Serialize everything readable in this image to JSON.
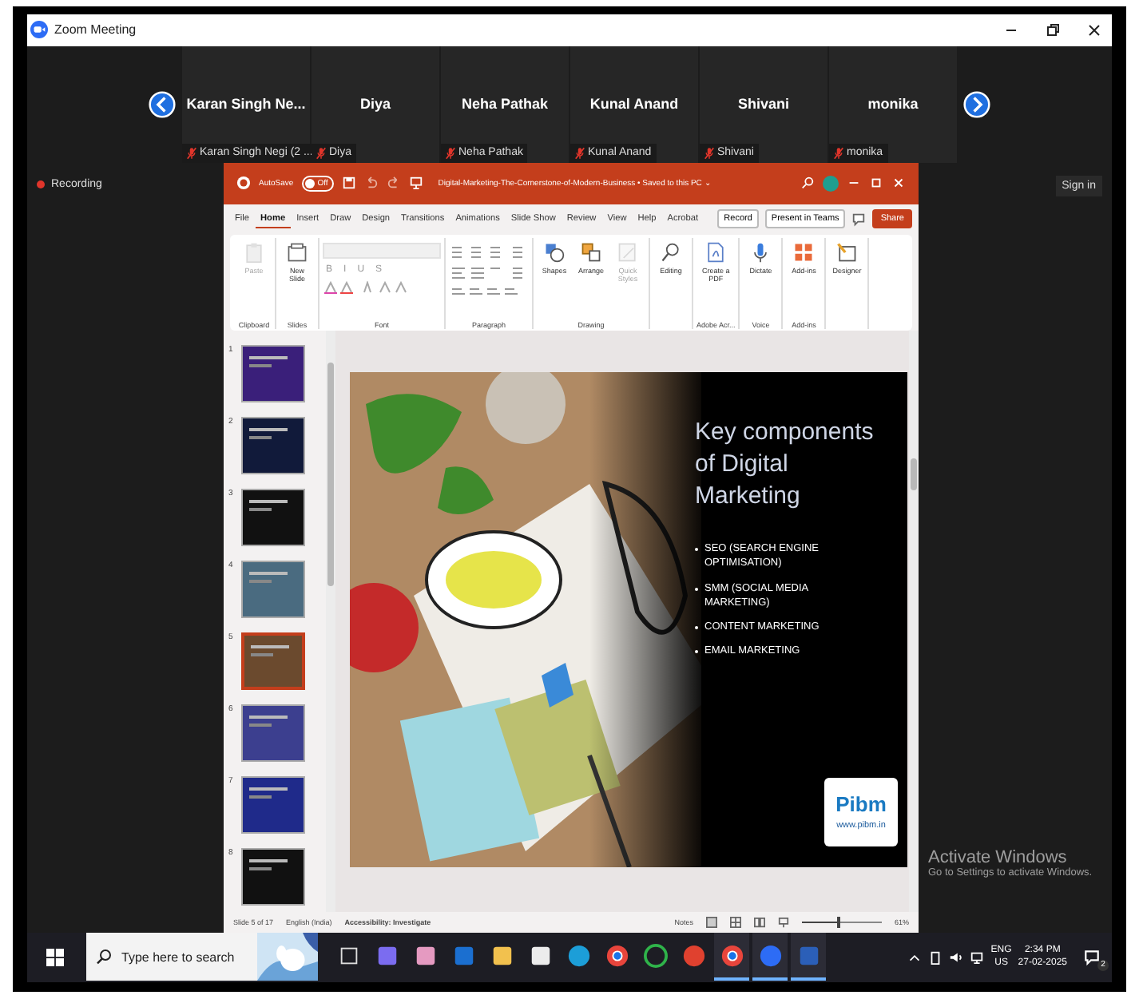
{
  "window": {
    "title": "Zoom Meeting"
  },
  "participants": [
    {
      "name": "Karan Singh Ne...",
      "label": "Karan Singh Negi (2 ...",
      "muted": true
    },
    {
      "name": "Diya",
      "label": "Diya",
      "muted": true
    },
    {
      "name": "Neha Pathak",
      "label": "Neha Pathak",
      "muted": true
    },
    {
      "name": "Kunal Anand",
      "label": "Kunal Anand",
      "muted": true
    },
    {
      "name": "Shivani",
      "label": "Shivani",
      "muted": true
    },
    {
      "name": "monika",
      "label": "monika",
      "muted": true
    }
  ],
  "recording": {
    "label": "Recording"
  },
  "sign_in": "Sign in",
  "powerpoint": {
    "autosave": {
      "label": "AutoSave",
      "state": "Off",
      "on": false
    },
    "file_title": "Digital-Marketing-The-Cornerstone-of-Modern-Business • Saved to this PC ⌄",
    "tabs": [
      {
        "label": "File",
        "selected": false
      },
      {
        "label": "Home",
        "selected": true
      },
      {
        "label": "Insert",
        "selected": false
      },
      {
        "label": "Draw",
        "selected": false
      },
      {
        "label": "Design",
        "selected": false
      },
      {
        "label": "Transitions",
        "selected": false
      },
      {
        "label": "Animations",
        "selected": false
      },
      {
        "label": "Slide Show",
        "selected": false
      },
      {
        "label": "Review",
        "selected": false
      },
      {
        "label": "View",
        "selected": false
      },
      {
        "label": "Help",
        "selected": false
      },
      {
        "label": "Acrobat",
        "selected": false
      }
    ],
    "record": "Record",
    "present": "Present in Teams",
    "share": "Share",
    "ribbon_groups": [
      {
        "kind": "buttons",
        "label": "Clipboard",
        "buttons": [
          {
            "kind": "paste",
            "label": "Paste",
            "disabled": true
          }
        ]
      },
      {
        "kind": "buttons",
        "label": "Slides",
        "buttons": [
          {
            "kind": "new-slide",
            "label": "New Slide",
            "disabled": false
          }
        ]
      },
      {
        "kind": "font",
        "label": "Font",
        "font_buttons": [
          "B",
          "I",
          "U",
          "S"
        ]
      },
      {
        "kind": "paragraph",
        "label": "Paragraph"
      },
      {
        "kind": "buttons",
        "label": "Drawing",
        "buttons": [
          {
            "kind": "shapes",
            "label": "Shapes",
            "disabled": false
          },
          {
            "kind": "arrange",
            "label": "Arrange",
            "disabled": false
          },
          {
            "kind": "quick-styles",
            "label": "Quick Styles",
            "disabled": true
          }
        ]
      },
      {
        "kind": "buttons",
        "buttons": [
          {
            "kind": "search",
            "label": "Editing",
            "disabled": false
          }
        ]
      },
      {
        "kind": "buttons",
        "label": "Adobe Acr...",
        "buttons": [
          {
            "kind": "pdf",
            "label": "Create a PDF",
            "disabled": false
          }
        ]
      },
      {
        "kind": "buttons",
        "label": "Voice",
        "buttons": [
          {
            "kind": "mic",
            "label": "Dictate",
            "disabled": false
          }
        ]
      },
      {
        "kind": "buttons",
        "label": "Add-ins",
        "buttons": [
          {
            "kind": "add-ins",
            "label": "Add-ins",
            "disabled": false
          }
        ]
      },
      {
        "kind": "buttons",
        "buttons": [
          {
            "kind": "designer",
            "label": "Designer",
            "disabled": false
          }
        ]
      }
    ],
    "thumbnails": [
      {
        "number": "1",
        "selected": false
      },
      {
        "number": "2",
        "selected": false
      },
      {
        "number": "3",
        "selected": false
      },
      {
        "number": "4",
        "selected": false
      },
      {
        "number": "5",
        "selected": true
      },
      {
        "number": "6",
        "selected": false
      },
      {
        "number": "7",
        "selected": false
      },
      {
        "number": "8",
        "selected": false
      }
    ],
    "slide": {
      "heading": "Key components of Digital Marketing",
      "bullets": [
        "SEO (SEARCH ENGINE OPTIMISATION)",
        "SMM (SOCIAL MEDIA MARKETING)",
        "CONTENT MARKETING",
        "EMAIL MARKETING"
      ],
      "logo": "Pibm",
      "logo_url": "www.pibm.in"
    },
    "status_bar": {
      "slide": "Slide 5 of 17",
      "language": "English (India)",
      "accessibility": "Accessibility: Investigate",
      "notes": "Notes",
      "zoom": "61%",
      "level": 0.45
    }
  },
  "activation": {
    "title": "Activate Windows",
    "hint": "Go to Settings to activate Windows."
  },
  "taskbar": {
    "search_placeholder": "Type here to search",
    "apps": [
      {
        "kind": "task-view",
        "active": false
      },
      {
        "kind": "copilot",
        "active": false
      },
      {
        "kind": "paint",
        "active": false
      },
      {
        "kind": "outlook",
        "active": false
      },
      {
        "kind": "explorer",
        "active": false
      },
      {
        "kind": "store",
        "active": false
      },
      {
        "kind": "edge",
        "active": false
      },
      {
        "kind": "chrome",
        "active": false
      },
      {
        "kind": "ring",
        "active": false
      },
      {
        "kind": "wps",
        "active": false
      },
      {
        "kind": "chrome",
        "active": true
      },
      {
        "kind": "zoom",
        "active": true
      },
      {
        "kind": "word",
        "active": true
      }
    ],
    "language": "ENG",
    "region": "US",
    "time": "2:34 PM",
    "date": "27-02-2025",
    "notifications": "2"
  }
}
